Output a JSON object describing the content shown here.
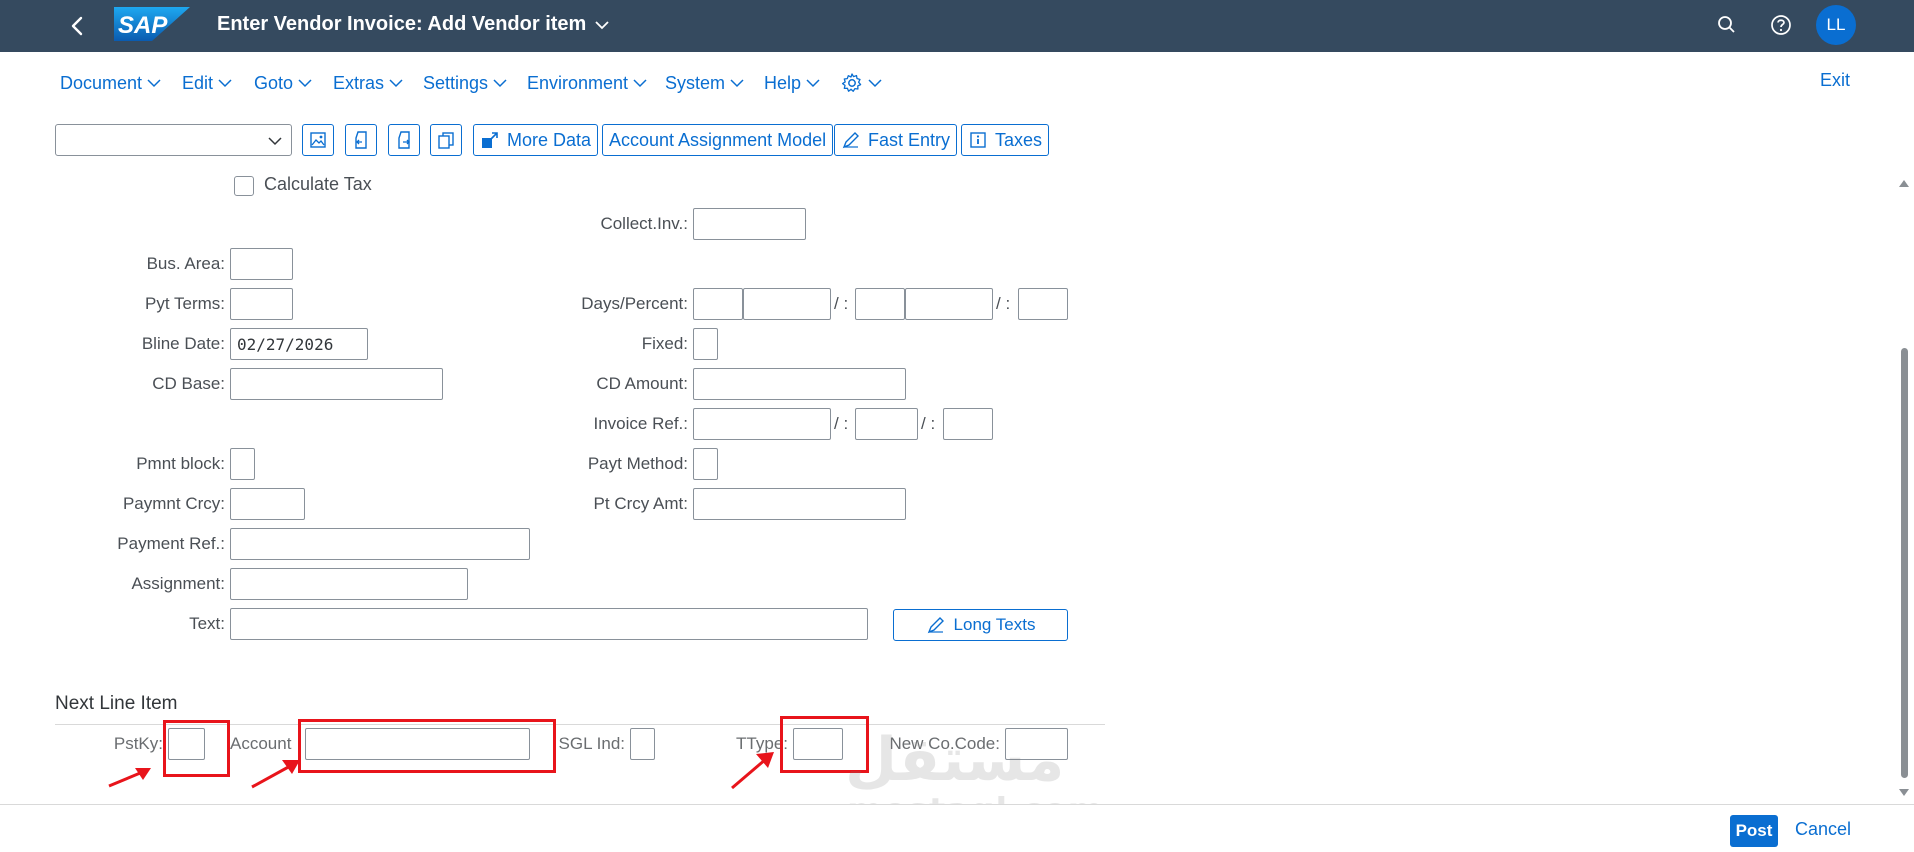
{
  "shell": {
    "title": "Enter Vendor Invoice: Add Vendor item",
    "logo_text": "SAP",
    "avatar_initials": "LL",
    "icons": [
      "back-icon",
      "search-icon",
      "help-icon"
    ],
    "brand_color": "#354a5f",
    "accent_color": "#0a6ed1"
  },
  "menu": {
    "items": [
      "Document",
      "Edit",
      "Goto",
      "Extras",
      "Settings",
      "Environment",
      "System",
      "Help"
    ],
    "settings_icon": "gear-icon",
    "exit_label": "Exit"
  },
  "toolbar": {
    "dropdown_value": "",
    "icon_buttons": [
      "image-icon",
      "document-back-icon",
      "document-forward-icon",
      "copy-icon"
    ],
    "more_data_label": "More Data",
    "account_assignment_label": "Account Assignment Model",
    "fast_entry_label": "Fast Entry",
    "taxes_label": "Taxes"
  },
  "form": {
    "calculate_tax": {
      "label": "Calculate Tax",
      "checked": false
    },
    "collect_inv": {
      "label": "Collect.Inv.:",
      "value": ""
    },
    "bus_area": {
      "label": "Bus. Area:",
      "value": ""
    },
    "pyt_terms": {
      "label": "Pyt Terms:",
      "value": ""
    },
    "days_percent": {
      "label": "Days/Percent:",
      "separator": "/ :"
    },
    "bline_date": {
      "label": "Bline Date:",
      "value": "02/27/2026"
    },
    "fixed": {
      "label": "Fixed:",
      "value": ""
    },
    "cd_base": {
      "label": "CD Base:",
      "value": ""
    },
    "cd_amount": {
      "label": "CD Amount:",
      "value": ""
    },
    "invoice_ref": {
      "label": "Invoice Ref.:",
      "separator": "/ :"
    },
    "pmnt_block": {
      "label": "Pmnt block:",
      "value": ""
    },
    "payt_method": {
      "label": "Payt Method:",
      "value": ""
    },
    "paymnt_crcy": {
      "label": "Paymnt Crcy:",
      "value": ""
    },
    "pt_crcy_amt": {
      "label": "Pt Crcy Amt:",
      "value": ""
    },
    "payment_ref": {
      "label": "Payment Ref.:",
      "value": ""
    },
    "assignment": {
      "label": "Assignment:",
      "value": ""
    },
    "text": {
      "label": "Text:",
      "value": ""
    },
    "long_texts_label": "Long Texts"
  },
  "next_line_item": {
    "title": "Next Line Item",
    "pstky": {
      "label": "PstKy:",
      "value": ""
    },
    "account": {
      "label": "Account",
      "value": ""
    },
    "sgl_ind": {
      "label": "SGL Ind:",
      "value": ""
    },
    "ttype": {
      "label": "TType:",
      "value": ""
    },
    "new_co_code": {
      "label": "New Co.Code:",
      "value": ""
    },
    "highlight_color": "#e8141b"
  },
  "footer": {
    "post_label": "Post",
    "cancel_label": "Cancel"
  },
  "watermark": {
    "arabic": "مستقل",
    "latin": "mostaql.com"
  }
}
